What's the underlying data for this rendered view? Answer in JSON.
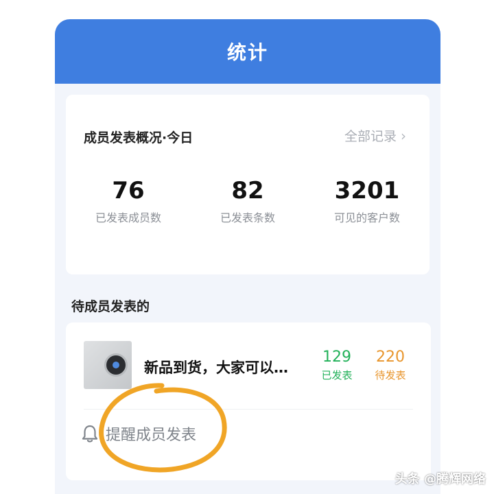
{
  "header": {
    "title": "统计"
  },
  "overview": {
    "title": "成员发表概况·今日",
    "link_label": "全部记录",
    "stats": [
      {
        "value": "76",
        "label": "已发表成员数"
      },
      {
        "value": "82",
        "label": "已发表条数"
      },
      {
        "value": "3201",
        "label": "可见的客户数"
      }
    ]
  },
  "pending": {
    "title": "待成员发表的",
    "item": {
      "text": "新品到货，大家可以…",
      "published_count": "129",
      "published_label": "已发表",
      "pending_count": "220",
      "pending_label": "待发表"
    },
    "remind_label": "提醒成员发表"
  },
  "watermark": "头条 @腾辉网络",
  "colors": {
    "header": "#3f7ee0",
    "published": "#22b159",
    "pending": "#e8952c",
    "annotation": "#f0a526"
  }
}
